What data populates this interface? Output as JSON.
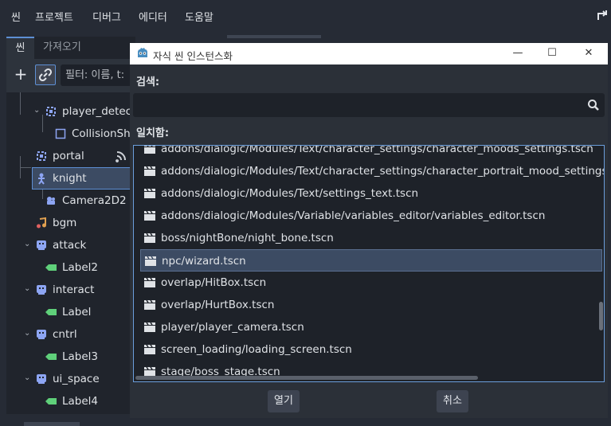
{
  "menubar": {
    "items": [
      "씬",
      "프로젝트",
      "디버그",
      "에디터",
      "도움말"
    ]
  },
  "left_panel": {
    "tabs": [
      "씬",
      "가져오기"
    ],
    "filter_placeholder": "필터: 이름, t:",
    "tree": [
      {
        "label": "player_detect",
        "icon": "area-icon"
      },
      {
        "label": "CollisionSh",
        "icon": "collision-shape-icon"
      },
      {
        "label": "portal",
        "icon": "area-icon"
      },
      {
        "label": "knight",
        "icon": "character-icon"
      },
      {
        "label": "Camera2D2",
        "icon": "camera-icon"
      },
      {
        "label": "bgm",
        "icon": "audio-icon"
      },
      {
        "label": "attack",
        "icon": "canvas-layer-icon"
      },
      {
        "label": "Label2",
        "icon": "label-icon"
      },
      {
        "label": "interact",
        "icon": "canvas-layer-icon"
      },
      {
        "label": "Label",
        "icon": "label-icon"
      },
      {
        "label": "cntrl",
        "icon": "canvas-layer-icon"
      },
      {
        "label": "Label3",
        "icon": "label-icon"
      },
      {
        "label": "ui_space",
        "icon": "canvas-layer-icon"
      },
      {
        "label": "Label4",
        "icon": "label-icon"
      }
    ]
  },
  "dialog": {
    "title": "자식 씬 인스턴스화",
    "search_label": "검색:",
    "search_value": "",
    "matches_label": "일치함:",
    "items": [
      "addons/dialogic/Modules/Text/character_settings/character_moods_settings.tscn",
      "addons/dialogic/Modules/Text/character_settings/character_portrait_mood_settings.",
      "addons/dialogic/Modules/Text/settings_text.tscn",
      "addons/dialogic/Modules/Variable/variables_editor/variables_editor.tscn",
      "boss/nightBone/night_bone.tscn",
      "npc/wizard.tscn",
      "overlap/HitBox.tscn",
      "overlap/HurtBox.tscn",
      "player/player_camera.tscn",
      "screen_loading/loading_screen.tscn",
      "stage/boss_stage.tscn"
    ],
    "selected_index": 5,
    "open_label": "열기",
    "cancel_label": "취소"
  },
  "colors": {
    "accent": "#5d8fd4",
    "selection": "#3c4b63",
    "label_icon": "#5fd07a",
    "node_icon": "#8da5f3"
  }
}
